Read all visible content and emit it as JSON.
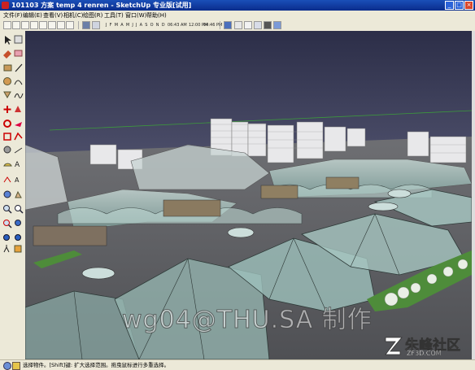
{
  "window": {
    "title": "101103 方案 temp 4 renren - SketchUp 专业版[试用]"
  },
  "menubar": {
    "items": [
      "文件(F)",
      "编辑(E)",
      "查看(V)",
      "相机(C)",
      "绘图(R)",
      "工具(T)",
      "窗口(W)",
      "帮助(H)"
    ]
  },
  "toolbar": {
    "months": "J F M A M J J A S O N D",
    "time_start": "06:43 AM",
    "time_noon": "12:00 PM",
    "time_end": "04:46 PM"
  },
  "statusbar": {
    "text": "选择物件。[Shift]键: 扩大选择范围。拖曳鼠标进行多重选择。"
  },
  "watermark": {
    "text": "wg04@THU.SA 制作"
  },
  "logo": {
    "name": "朱峰社区",
    "url": "ZF3D.COM"
  },
  "colors": {
    "sky_top": "#2c2e48",
    "sky_bottom": "#8e8ea6",
    "ground": "#5f6064",
    "glass": "#9fc1bb",
    "lawn": "#4e8c3a",
    "title_bar": "#0a2c8c"
  }
}
